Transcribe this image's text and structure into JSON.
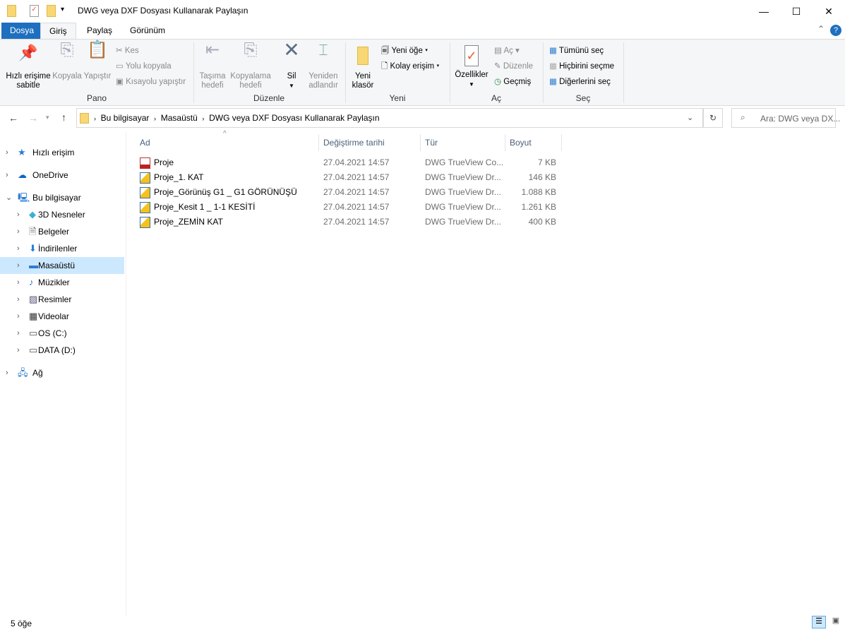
{
  "window": {
    "title": "DWG veya DXF Dosyası Kullanarak Paylaşın",
    "minimize": "—",
    "maximize": "☐",
    "close": "✕"
  },
  "tabs": [
    {
      "label": "Dosya"
    },
    {
      "label": "Giriş"
    },
    {
      "label": "Paylaş"
    },
    {
      "label": "Görünüm"
    }
  ],
  "ribbon": {
    "pano": {
      "label": "Pano",
      "pin": "Hızlı erişime sabitle",
      "pin1": "Hızlı erişime",
      "pin2": "sabitle",
      "copy": "Kopyala",
      "paste": "Yapıştır",
      "cut": "Kes",
      "copy_path": "Yolu kopyala",
      "paste_shortcut": "Kısayolu yapıştır"
    },
    "duzenle": {
      "label": "Düzenle",
      "move1": "Taşıma",
      "move2": "hedefi",
      "copy1": "Kopyalama",
      "copy2": "hedefi",
      "delete": "Sil",
      "rename1": "Yeniden",
      "rename2": "adlandır"
    },
    "yeni": {
      "label": "Yeni",
      "new_folder1": "Yeni",
      "new_folder2": "klasör",
      "new_item": "Yeni öğe",
      "easy_access": "Kolay erişim"
    },
    "ac": {
      "label": "Aç",
      "properties": "Özellikler",
      "open": "Aç",
      "edit": "Düzenle",
      "history": "Geçmiş"
    },
    "sec": {
      "label": "Seç",
      "select_all": "Tümünü seç",
      "select_none": "Hiçbirini seçme",
      "invert": "Diğerlerini seç"
    }
  },
  "address": {
    "path": [
      "Bu bilgisayar",
      "Masaüstü",
      "DWG veya DXF Dosyası Kullanarak Paylaşın"
    ],
    "search_placeholder": "Ara: DWG veya DX..."
  },
  "nav": [
    {
      "label": "Hızlı erişim",
      "level": 0
    },
    {
      "label": "OneDrive",
      "level": 0
    },
    {
      "label": "Bu bilgisayar",
      "level": 0,
      "expanded": true
    },
    {
      "label": "3D Nesneler",
      "level": 1
    },
    {
      "label": "Belgeler",
      "level": 1
    },
    {
      "label": "İndirilenler",
      "level": 1
    },
    {
      "label": "Masaüstü",
      "level": 1,
      "selected": true
    },
    {
      "label": "Müzikler",
      "level": 1
    },
    {
      "label": "Resimler",
      "level": 1
    },
    {
      "label": "Videolar",
      "level": 1
    },
    {
      "label": "OS (C:)",
      "level": 1
    },
    {
      "label": "DATA (D:)",
      "level": 1
    },
    {
      "label": "Ağ",
      "level": 0
    }
  ],
  "columns": {
    "name": "Ad",
    "date": "Değiştirme tarihi",
    "type": "Tür",
    "size": "Boyut"
  },
  "files": [
    {
      "name": "Proje",
      "date": "27.04.2021 14:57",
      "type": "DWG TrueView Co...",
      "size": "7 KB",
      "icon": "ctb"
    },
    {
      "name": "Proje_1. KAT",
      "date": "27.04.2021 14:57",
      "type": "DWG TrueView Dr...",
      "size": "146 KB",
      "icon": "dwg"
    },
    {
      "name": "Proje_Görünüş G1 _ G1 GÖRÜNÜŞÜ",
      "date": "27.04.2021 14:57",
      "type": "DWG TrueView Dr...",
      "size": "1.088 KB",
      "icon": "dwg"
    },
    {
      "name": "Proje_Kesit 1 _ 1-1 KESİTİ",
      "date": "27.04.2021 14:57",
      "type": "DWG TrueView Dr...",
      "size": "1.261 KB",
      "icon": "dwg"
    },
    {
      "name": "Proje_ZEMİN KAT",
      "date": "27.04.2021 14:57",
      "type": "DWG TrueView Dr...",
      "size": "400 KB",
      "icon": "dwg"
    }
  ],
  "status": {
    "count": "5 öğe"
  },
  "colors": {
    "accent": "#1e6fbf",
    "selected": "#cce8ff"
  }
}
